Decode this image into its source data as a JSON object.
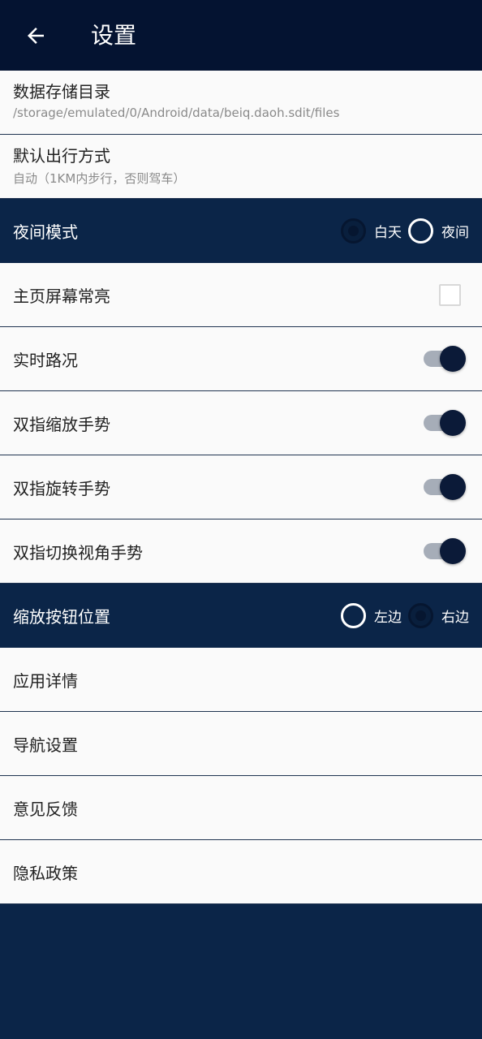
{
  "appbar": {
    "title": "设置",
    "back_icon": "arrow-left-icon"
  },
  "settings": {
    "storage": {
      "title": "数据存储目录",
      "value": "/storage/emulated/0/Android/data/beiq.daoh.sdit/files"
    },
    "travel": {
      "title": "默认出行方式",
      "value": "自动（1KM内步行，否则驾车）"
    },
    "night_mode": {
      "title": "夜间模式",
      "options": [
        {
          "label": "白天",
          "checked": true
        },
        {
          "label": "夜间",
          "checked": false
        }
      ]
    },
    "screen_on": {
      "title": "主页屏幕常亮",
      "checked": false
    },
    "traffic": {
      "title": "实时路况",
      "on": true
    },
    "zoom_gesture": {
      "title": "双指缩放手势",
      "on": true
    },
    "rotate_gesture": {
      "title": "双指旋转手势",
      "on": true
    },
    "tilt_gesture": {
      "title": "双指切换视角手势",
      "on": true
    },
    "zoom_button": {
      "title": "缩放按钮位置",
      "options": [
        {
          "label": "左边",
          "checked": false
        },
        {
          "label": "右边",
          "checked": true
        }
      ]
    },
    "app_detail": {
      "title": "应用详情"
    },
    "nav_settings": {
      "title": "导航设置"
    },
    "feedback": {
      "title": "意见反馈"
    },
    "privacy": {
      "title": "隐私政策"
    }
  },
  "colors": {
    "appbar": "#041331",
    "section": "#0b2548",
    "row_bg": "#fafafa",
    "accent": "#0b1a38",
    "track": "#a6adb8"
  }
}
